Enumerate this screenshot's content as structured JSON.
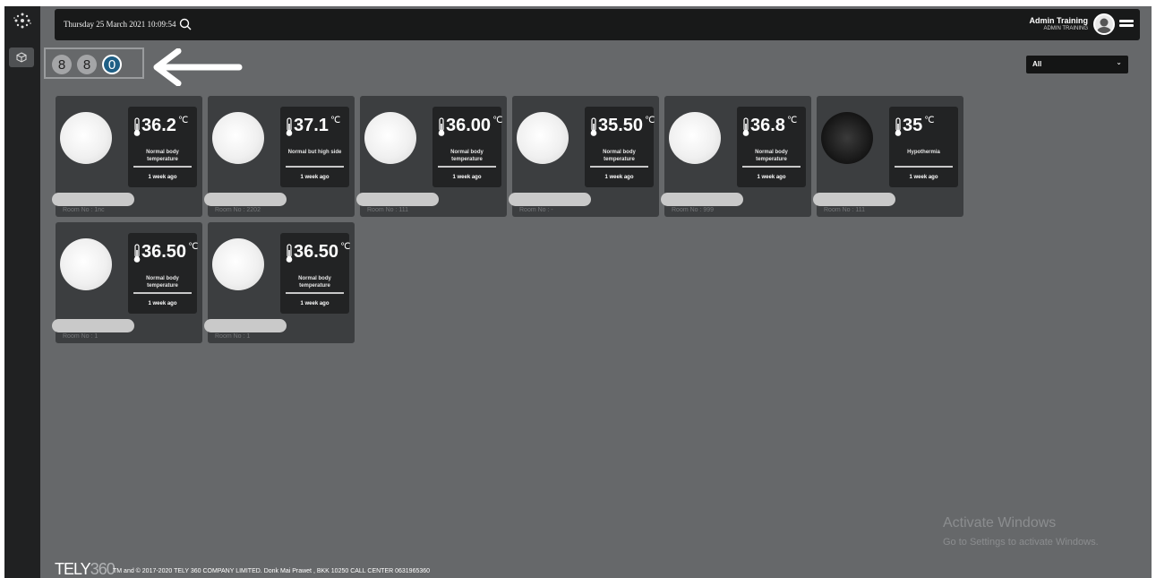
{
  "header": {
    "datetime": "Thursday 25 March 2021 10:09:54",
    "user_name": "Admin Training",
    "user_role": "ADMIN TRAINING"
  },
  "counters": [
    {
      "value": "8",
      "color": "#a4a5a7"
    },
    {
      "value": "8",
      "color": "#a4a5a7"
    },
    {
      "value": "0",
      "color": "#1f5f85"
    }
  ],
  "filter": {
    "selected": "All"
  },
  "cards": [
    {
      "temp": "36.2",
      "unit": "℃",
      "status": "Normal body temperature",
      "ago": "1 week ago",
      "room": "Room No : 1nc",
      "photo": "light"
    },
    {
      "temp": "37.1",
      "unit": "℃",
      "status": "Normal but high side",
      "ago": "1 week ago",
      "room": "Room No : 2202",
      "photo": "light"
    },
    {
      "temp": "36.00",
      "unit": "℃",
      "status": "Normal body temperature",
      "ago": "1 week ago",
      "room": "Room No : 111",
      "photo": "light"
    },
    {
      "temp": "35.50",
      "unit": "℃",
      "status": "Normal body temperature",
      "ago": "1 week ago",
      "room": "Room No : -",
      "photo": "light"
    },
    {
      "temp": "36.8",
      "unit": "℃",
      "status": "Normal body temperature",
      "ago": "1 week ago",
      "room": "Room No : 999",
      "photo": "light"
    },
    {
      "temp": "35",
      "unit": "℃",
      "status": "Hypothermia",
      "ago": "1 week ago",
      "room": "Room No : 111",
      "photo": "dark"
    },
    {
      "temp": "36.50",
      "unit": "℃",
      "status": "Normal body temperature",
      "ago": "1 week ago",
      "room": "Room No : 1",
      "photo": "light"
    },
    {
      "temp": "36.50",
      "unit": "℃",
      "status": "Normal body temperature",
      "ago": "1 week ago",
      "room": "Room No : 1",
      "photo": "light"
    }
  ],
  "watermark": {
    "title": "Activate Windows",
    "subtitle": "Go to Settings to activate Windows."
  },
  "footer": {
    "logo_main": "TELY",
    "logo_num": "360",
    "text": "TM and © 2017-2020 TELY 360 COMPANY LIMITED. Donk Mai Prawet , BKK 10250 CALL CENTER 0631965360"
  }
}
